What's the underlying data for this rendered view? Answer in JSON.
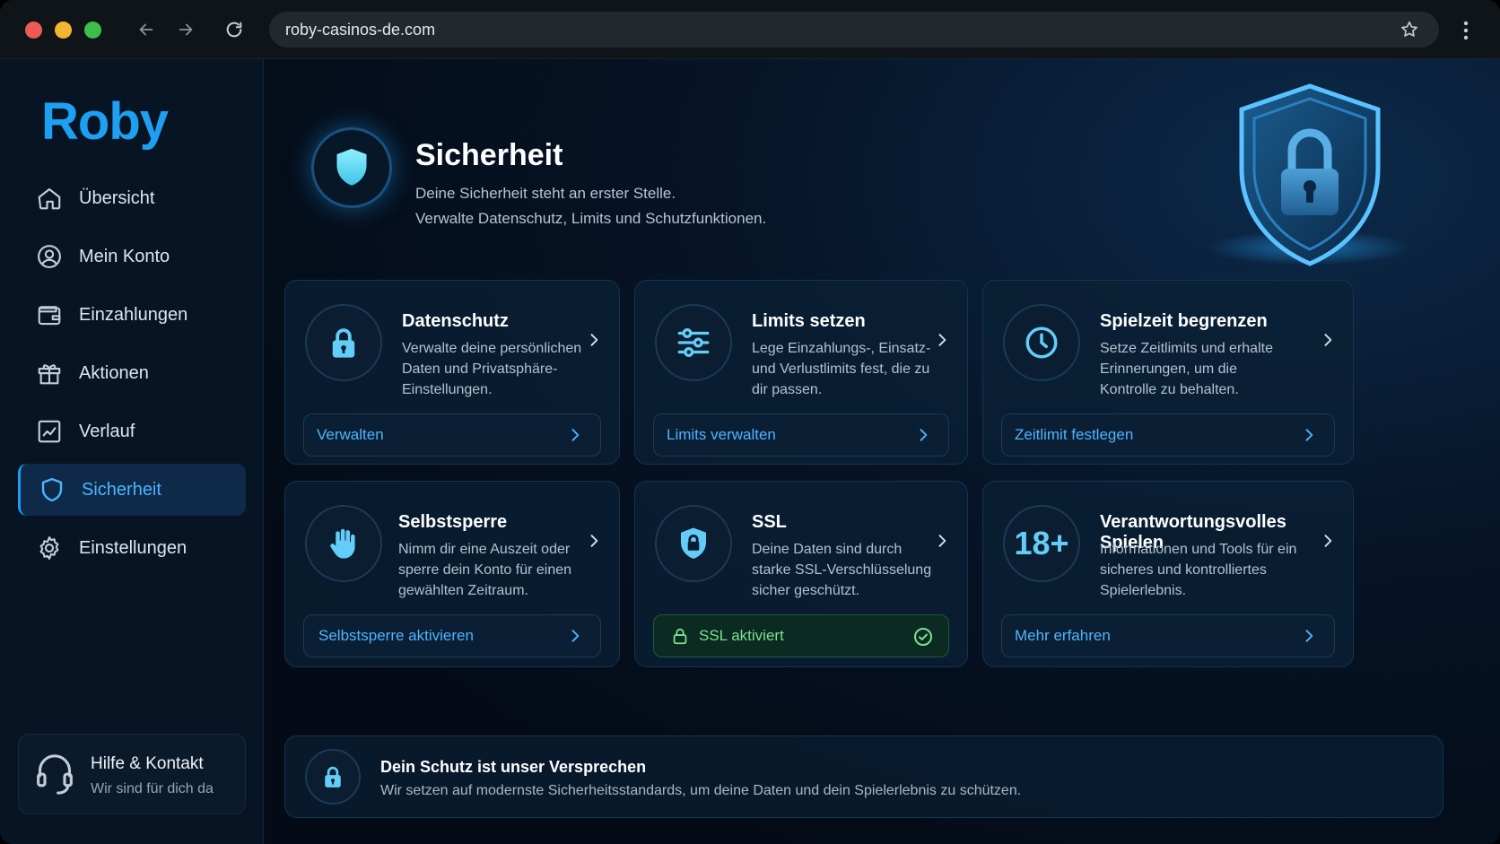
{
  "browser": {
    "url": "roby-casinos-de.com"
  },
  "sidebar": {
    "logo": "Roby",
    "items": [
      {
        "label": "Übersicht",
        "icon": "home-icon"
      },
      {
        "label": "Mein Konto",
        "icon": "user-circle-icon"
      },
      {
        "label": "Einzahlungen",
        "icon": "wallet-icon"
      },
      {
        "label": "Aktionen",
        "icon": "gift-icon"
      },
      {
        "label": "Verlauf",
        "icon": "chart-line-icon"
      },
      {
        "label": "Sicherheit",
        "icon": "shield-icon",
        "active": true
      },
      {
        "label": "Einstellungen",
        "icon": "gear-icon"
      }
    ],
    "help": {
      "title": "Hilfe & Kontakt",
      "subtitle": "Wir sind für dich da"
    }
  },
  "header": {
    "title": "Sicherheit",
    "subtitle_line1": "Deine Sicherheit steht an erster Stelle.",
    "subtitle_line2": "Verwalte Datenschutz, Limits und Schutzfunktionen."
  },
  "cards": [
    {
      "title": "Datenschutz",
      "text": "Verwalte deine persönlichen Daten und Privatsphäre-Einstellungen.",
      "action": "Verwalten",
      "icon": "lock-icon"
    },
    {
      "title": "Limits setzen",
      "text": "Lege Einzahlungs-, Einsatz- und Verlustlimits fest, die zu dir passen.",
      "action": "Limits verwalten",
      "icon": "sliders-icon"
    },
    {
      "title": "Spielzeit begrenzen",
      "text": "Setze Zeitlimits und erhalte Erinnerungen, um die Kontrolle zu behalten.",
      "action": "Zeitlimit festlegen",
      "icon": "clock-icon"
    },
    {
      "title": "Selbstsperre",
      "text": "Nimm dir eine Auszeit oder sperre dein Konto für einen gewählten Zeitraum.",
      "action": "Selbstsperre aktivieren",
      "icon": "hand-stop-icon"
    },
    {
      "title": "SSL",
      "text": "Deine Daten sind durch starke SSL-Verschlüsselung sicher geschützt.",
      "action": "SSL aktiviert",
      "icon": "shield-lock-icon"
    },
    {
      "title": "Verantwortungsvolles Spielen",
      "text": "Informationen und Tools für ein sicheres und kontrolliertes Spielerlebnis.",
      "action": "Mehr erfahren",
      "icon_text": "18+"
    }
  ],
  "promise": {
    "title": "Dein Schutz ist unser Versprechen",
    "text": "Wir setzen auf modernste Sicherheitsstandards, um deine Daten und dein Spielerlebnis zu schützen."
  },
  "colors": {
    "accent": "#1ea0f2",
    "icon": "#63cdf7",
    "success": "#7be08e",
    "background": "#050d18"
  }
}
